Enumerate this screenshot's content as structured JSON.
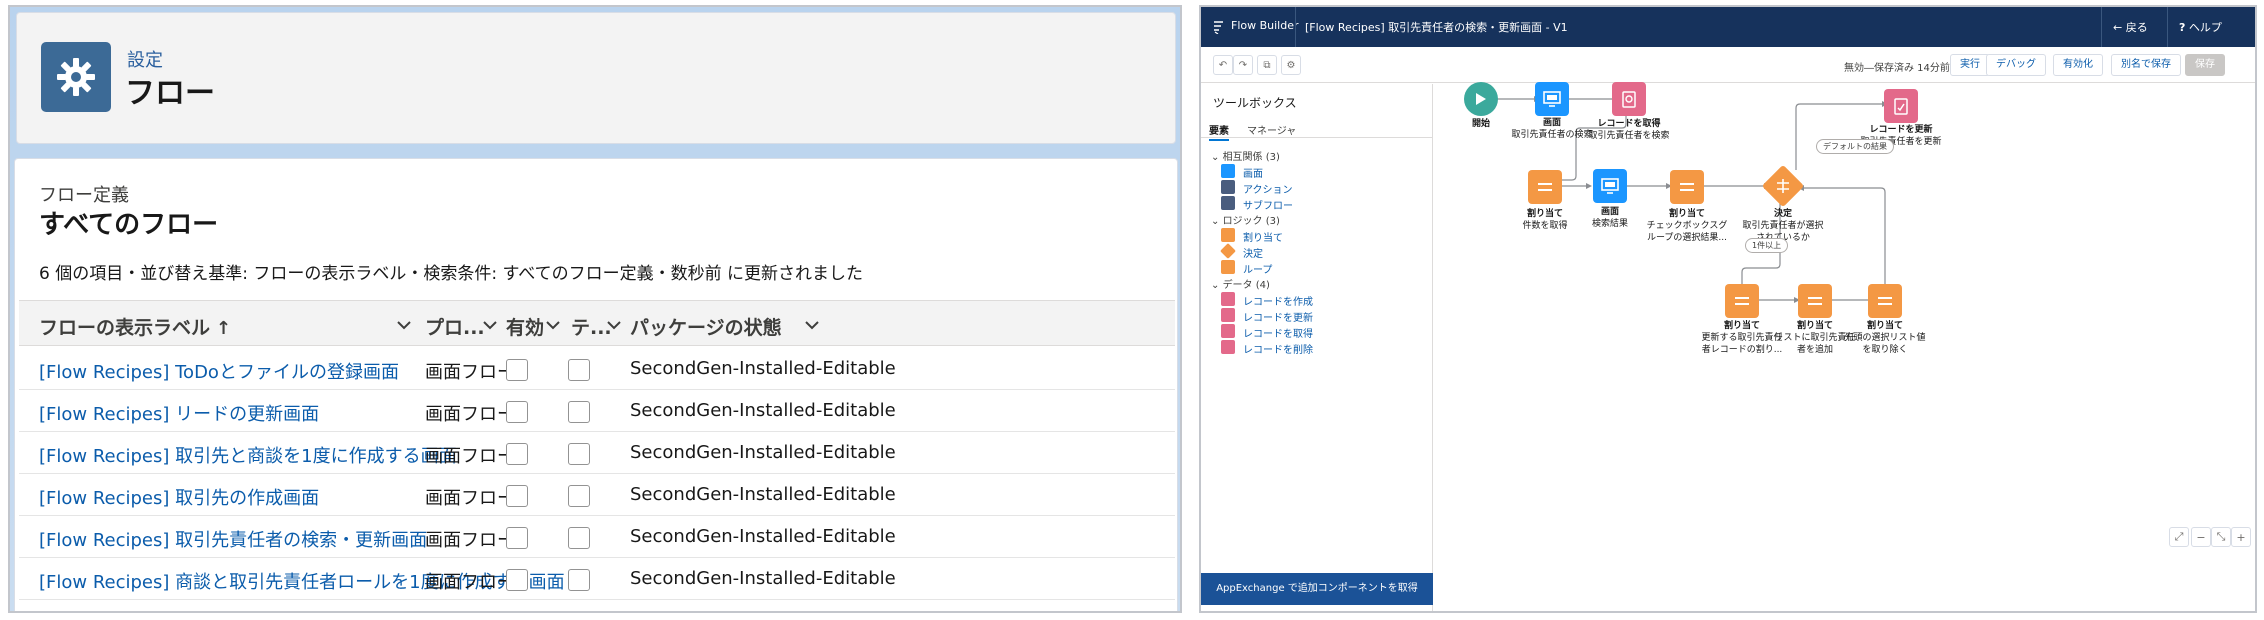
{
  "left": {
    "setup": {
      "label": "設定",
      "title": "フロー"
    },
    "list": {
      "subtitle": "フロー定義",
      "title": "すべてのフロー",
      "info": "6 個の項目・並び替え基準: フローの表示ラベル・検索条件: すべてのフロー定義・数秒前 に更新されました",
      "columns": [
        "フローの表示ラベル",
        "プロ...",
        "有効",
        "テ...",
        "パッケージの状態"
      ],
      "sort_indicator": "↑",
      "rows": [
        {
          "label": "[Flow Recipes] ToDoとファイルの登録画面",
          "type": "画面フロー",
          "package": "SecondGen-Installed-Editable"
        },
        {
          "label": "[Flow Recipes] リードの更新画面",
          "type": "画面フロー",
          "package": "SecondGen-Installed-Editable"
        },
        {
          "label": "[Flow Recipes] 取引先と商談を1度に作成する画面",
          "type": "画面フロー",
          "package": "SecondGen-Installed-Editable"
        },
        {
          "label": "[Flow Recipes] 取引先の作成画面",
          "type": "画面フロー",
          "package": "SecondGen-Installed-Editable"
        },
        {
          "label": "[Flow Recipes] 取引先責任者の検索・更新画面",
          "type": "画面フロー",
          "package": "SecondGen-Installed-Editable"
        },
        {
          "label": "[Flow Recipes] 商談と取引先責任者ロールを1度に作成する画面",
          "type": "画面フロー",
          "package": "SecondGen-Installed-Editable"
        }
      ]
    }
  },
  "right": {
    "topbar": {
      "app": "Flow Builder",
      "title": "[Flow Recipes] 取引先責任者の検索・更新画面 - V1",
      "back": "戻る",
      "help": "ヘルプ"
    },
    "toolbar": {
      "status": "無効―保存済み 14分前",
      "run": "実行",
      "debug": "デバッグ",
      "activate": "有効化",
      "save_as": "別名で保存",
      "save": "保存"
    },
    "toolbox": {
      "title": "ツールボックス",
      "tabs": [
        "要素",
        "マネージャ"
      ],
      "sections": [
        {
          "title": "相互関係 (3)",
          "items": [
            {
              "label": "画面",
              "icon": "screen-icon"
            },
            {
              "label": "アクション",
              "icon": "action-icon"
            },
            {
              "label": "サブフロー",
              "icon": "subflow-icon"
            }
          ]
        },
        {
          "title": "ロジック (3)",
          "items": [
            {
              "label": "割り当て",
              "icon": "assignment-icon"
            },
            {
              "label": "決定",
              "icon": "decision-icon"
            },
            {
              "label": "ループ",
              "icon": "loop-icon"
            }
          ]
        },
        {
          "title": "データ (4)",
          "items": [
            {
              "label": "レコードを作成",
              "icon": "record-create-icon"
            },
            {
              "label": "レコードを更新",
              "icon": "record-update-icon"
            },
            {
              "label": "レコードを取得",
              "icon": "record-lookup-icon"
            },
            {
              "label": "レコードを削除",
              "icon": "record-delete-icon"
            }
          ]
        }
      ],
      "appexchange": "AppExchange で追加コンポーネントを取得"
    },
    "canvas": {
      "start": {
        "title": "開始"
      },
      "screen1": {
        "title": "画面",
        "desc": "取引先責任者の検索"
      },
      "lookup": {
        "title": "レコードを取得",
        "desc": "取引先責任者を検索"
      },
      "assign1": {
        "title": "割り当て",
        "desc": "件数を取得"
      },
      "screen2": {
        "title": "画面",
        "desc": "検索結果"
      },
      "assign2": {
        "title": "割り当て",
        "desc1": "チェックボックスグ",
        "desc2": "ループの選択結果..."
      },
      "decision": {
        "title": "決定",
        "desc1": "取引先責任者が選択",
        "desc2": "されているか"
      },
      "update": {
        "title": "レコードを更新",
        "desc": "取引先責任者を更新"
      },
      "default_path": "デフォルトの結果",
      "one_or_more": "1件以上",
      "assign3": {
        "title": "割り当て",
        "desc1": "更新する取引先責任",
        "desc2": "者レコードの割り..."
      },
      "assign4": {
        "title": "割り当て",
        "desc1": "リストに取引先責任",
        "desc2": "者を追加"
      },
      "assign5": {
        "title": "割り当て",
        "desc1": "先頭の選択リスト値",
        "desc2": "を取り除く"
      }
    },
    "colors": {
      "navy": "#16325c",
      "screen_blue": "#1b96ff",
      "assign_orange": "#f49844",
      "record_pink": "#e3698a",
      "start_teal": "#3ba99c"
    }
  }
}
